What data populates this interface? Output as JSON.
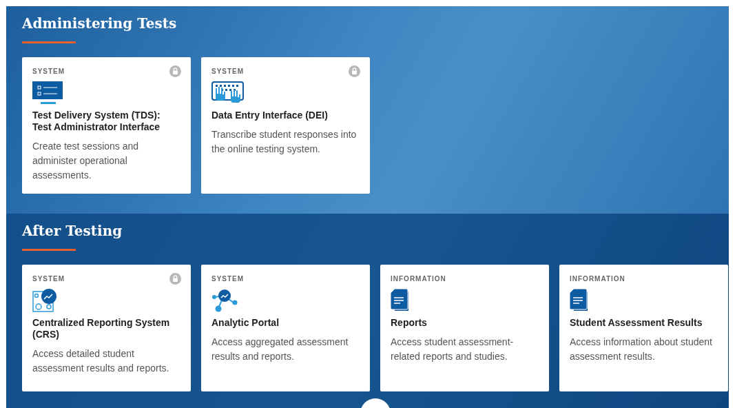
{
  "sections": [
    {
      "title": "Administering Tests",
      "cards": [
        {
          "category": "SYSTEM",
          "locked": true,
          "kind": "monitor",
          "title": "Test Delivery System (TDS): Test Administrator Interface",
          "description": "Create test sessions and administer operational assessments."
        },
        {
          "category": "SYSTEM",
          "locked": true,
          "kind": "keyboard",
          "title": "Data Entry Interface (DEI)",
          "description": "Transcribe student responses into the online testing system."
        }
      ]
    },
    {
      "title": "After Testing",
      "cards": [
        {
          "category": "SYSTEM",
          "locked": true,
          "kind": "reporting",
          "title": "Centralized Reporting System (CRS)",
          "description": "Access detailed student assessment results and reports."
        },
        {
          "category": "SYSTEM",
          "locked": false,
          "kind": "analytic",
          "title": "Analytic Portal",
          "description": "Access aggregated assessment results and reports."
        },
        {
          "category": "INFORMATION",
          "locked": false,
          "kind": "document",
          "title": "Reports",
          "description": "Access student assessment-related reports and studies."
        },
        {
          "category": "INFORMATION",
          "locked": false,
          "kind": "document",
          "title": "Student Assessment Results",
          "description": "Access information about student assessment results."
        }
      ]
    }
  ]
}
